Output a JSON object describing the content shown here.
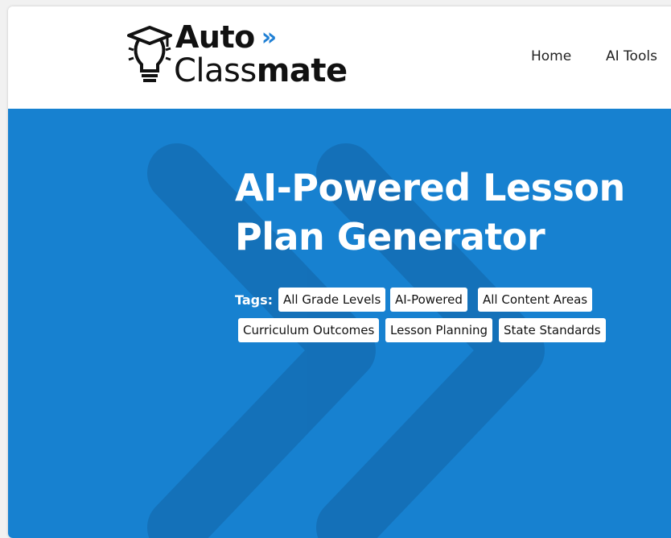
{
  "logo": {
    "line1": "Auto",
    "chevron": "»",
    "line2_plain": "Class",
    "line2_bold": "mate",
    "icon": "lightbulb-graduation-cap-icon"
  },
  "nav": {
    "items": [
      {
        "label": "Home"
      },
      {
        "label": "AI Tools"
      }
    ]
  },
  "hero": {
    "title_line1": "AI-Powered Lesson",
    "title_line2": "Plan Generator",
    "tags_label": "Tags:",
    "tags": [
      "All Grade Levels",
      "AI-Powered",
      "All Content Areas",
      "Curriculum Outcomes",
      "Lesson Planning",
      "State Standards"
    ]
  },
  "colors": {
    "hero_bg": "#1781d0",
    "accent": "#1f7fd4",
    "header_bg": "#ffffff"
  }
}
